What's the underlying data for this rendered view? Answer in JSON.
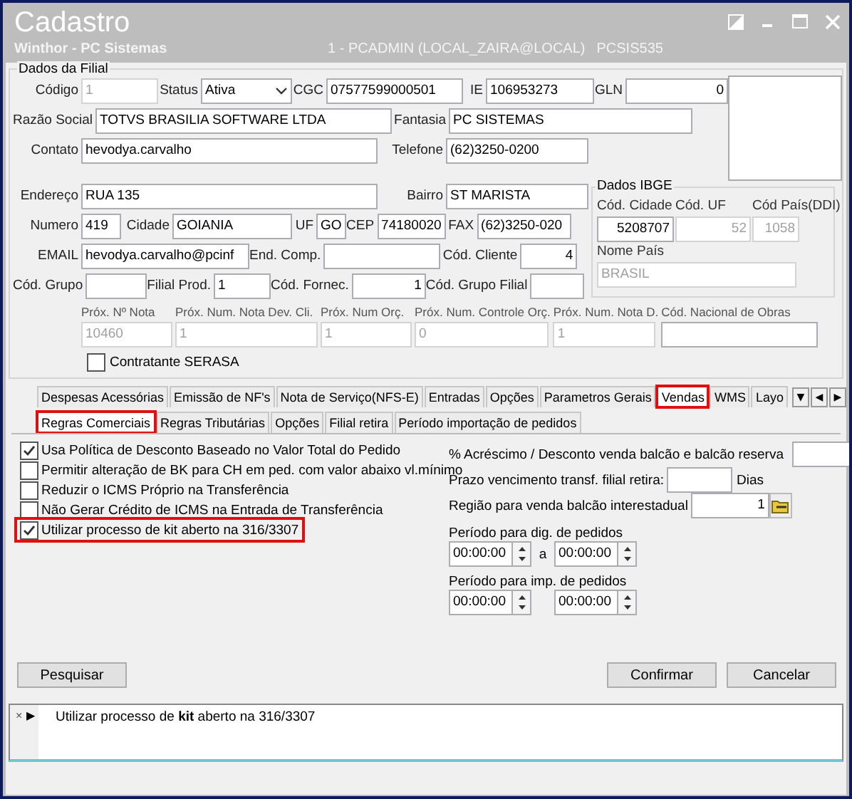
{
  "window": {
    "title": "Cadastro",
    "subtitle": "Winthor - PC Sistemas",
    "session": "1 - PCADMIN (LOCAL_ZAIRA@LOCAL)",
    "program": "PCSIS535"
  },
  "filial": {
    "title": "Dados da Filial",
    "lines": [
      {
        "fields": [
          {
            "label": "Código",
            "value": "1",
            "kind": "text",
            "disabled": true
          },
          {
            "label": "Status",
            "value": "Ativa",
            "kind": "select",
            "disabled": false
          },
          {
            "label": "CGC",
            "value": "07577599000501",
            "kind": "text",
            "disabled": false
          },
          {
            "label": "IE",
            "value": "106953273",
            "kind": "text",
            "disabled": false
          },
          {
            "label": "GLN",
            "value": "0",
            "kind": "number",
            "disabled": false
          }
        ]
      },
      {
        "fields": [
          {
            "label": "Razão Social",
            "value": "TOTVS BRASILIA SOFTWARE LTDA",
            "kind": "text",
            "disabled": false
          },
          {
            "label": "Fantasia",
            "value": "PC SISTEMAS",
            "kind": "text",
            "disabled": false
          }
        ]
      },
      {
        "fields": [
          {
            "label": "Contato",
            "value": "hevodya.carvalho",
            "kind": "text",
            "disabled": false
          },
          {
            "label": "Telefone",
            "value": "(62)3250-0200",
            "kind": "text",
            "disabled": false
          }
        ]
      },
      {
        "fields": [
          {
            "label": "Endereço",
            "value": "RUA 135",
            "kind": "text",
            "disabled": false
          },
          {
            "label": "Bairro",
            "value": "ST MARISTA",
            "kind": "text",
            "disabled": false
          }
        ]
      },
      {
        "fields": [
          {
            "label": "Numero",
            "value": "419",
            "kind": "text",
            "disabled": false
          },
          {
            "label": "Cidade",
            "value": "GOIANIA",
            "kind": "text",
            "disabled": false
          },
          {
            "label": "UF",
            "value": "GO",
            "kind": "text",
            "disabled": false
          },
          {
            "label": "CEP",
            "value": "74180020",
            "kind": "text",
            "disabled": false
          },
          {
            "label": "FAX",
            "value": "(62)3250-020",
            "kind": "text",
            "disabled": false
          }
        ]
      },
      {
        "fields": [
          {
            "label": "EMAIL",
            "value": "hevodya.carvalho@pcinf",
            "kind": "text",
            "disabled": false
          },
          {
            "label": "End. Comp.",
            "kind": "text",
            "disabled": false
          },
          {
            "label": "Cód. Cliente",
            "value": "4",
            "kind": "number",
            "disabled": false
          }
        ]
      },
      {
        "fields": [
          {
            "label": "Cód. Grupo",
            "kind": "text",
            "disabled": false
          },
          {
            "label": "Filial Prod.",
            "value": "1",
            "kind": "text",
            "disabled": false
          },
          {
            "label": "Cód. Fornec.",
            "value": "1",
            "kind": "number",
            "disabled": false
          },
          {
            "label": "Cód. Grupo Filial",
            "kind": "text",
            "disabled": false
          }
        ]
      }
    ],
    "ibge": {
      "title": "Dados IBGE",
      "fields": [
        {
          "label": "Cód. Cidade",
          "value": "5208707",
          "kind": "number",
          "disabled": false
        },
        {
          "label": "Cód. UF",
          "value": "52",
          "kind": "number",
          "disabled": true
        },
        {
          "label": "Cód País(DDI)",
          "value": "1058",
          "kind": "number",
          "disabled": true
        }
      ],
      "country": {
        "label": "Nome País",
        "value": "BRASIL",
        "kind": "text",
        "disabled": true
      }
    },
    "numbering": [
      {
        "label": "Próx. Nº Nota",
        "value": "10460",
        "disabled": true
      },
      {
        "label": "Próx. Num. Nota Dev. Cli.",
        "value": "1",
        "disabled": true
      },
      {
        "label": "Próx. Num Orç.",
        "value": "1",
        "disabled": true
      },
      {
        "label": "Próx. Num. Controle Orç.",
        "value": "0",
        "disabled": true
      },
      {
        "label": "Próx. Num. Nota D.",
        "value": "1",
        "disabled": true
      },
      {
        "label": "Cód. Nacional de Obras",
        "disabled": false
      }
    ],
    "serasa": {
      "label": "Contratante SERASA",
      "checked": false
    }
  },
  "tabs": [
    {
      "label": "Despesas Acessórias",
      "selected": false,
      "highlighted": false
    },
    {
      "label": "Emissão de NF's",
      "selected": false,
      "highlighted": false
    },
    {
      "label": "Nota de Serviço(NFS-E)",
      "selected": false,
      "highlighted": false
    },
    {
      "label": "Entradas",
      "selected": false,
      "highlighted": false
    },
    {
      "label": "Opções",
      "selected": false,
      "highlighted": false
    },
    {
      "label": "Parametros Gerais",
      "selected": false,
      "highlighted": false
    },
    {
      "label": "Vendas",
      "selected": true,
      "highlighted": true
    },
    {
      "label": "WMS",
      "selected": false,
      "highlighted": false
    },
    {
      "label": "Layo",
      "selected": false,
      "highlighted": false
    }
  ],
  "tab_scroll": [
    "▼",
    "◀",
    "▶"
  ],
  "subtabs": [
    {
      "label": "Regras Comerciais",
      "selected": true,
      "highlighted": true
    },
    {
      "label": "Regras Tributárias",
      "selected": false,
      "highlighted": false
    },
    {
      "label": "Opções",
      "selected": false,
      "highlighted": false
    },
    {
      "label": "Filial retira",
      "selected": false,
      "highlighted": false
    },
    {
      "label": "Período importação de pedidos",
      "selected": false,
      "highlighted": false
    }
  ],
  "options": [
    {
      "label": "Usa Política de Desconto Baseado no Valor Total do Pedido",
      "checked": true,
      "highlighted": false
    },
    {
      "label": "Permitir alteração de BK para CH em ped. com valor abaixo vl.mínimo",
      "checked": false,
      "highlighted": false
    },
    {
      "label": "Reduzir o ICMS Próprio na Transferência",
      "checked": false,
      "highlighted": false
    },
    {
      "label": "Não Gerar Crédito de ICMS na Entrada de Transferência",
      "checked": false,
      "highlighted": false
    },
    {
      "label": "Utilizar processo de kit aberto na 316/3307",
      "checked": true,
      "highlighted": true
    }
  ],
  "vendas": {
    "acrescimo": {
      "label": "% Acréscimo / Desconto venda balcão e balcão reserva"
    },
    "prazo": {
      "label": "Prazo vencimento transf. filial retira:",
      "unit": "Dias"
    },
    "regiao": {
      "label": "Região para venda balcão interestadual",
      "value": "1"
    },
    "periods": [
      {
        "label": "Período para dig. de pedidos",
        "from": "00:00:00",
        "separator": "a",
        "to": "00:00:00"
      },
      {
        "label": "Período para imp. de pedidos",
        "from": "00:00:00",
        "to": "00:00:00"
      }
    ]
  },
  "buttons": {
    "search": "Pesquisar",
    "confirm": "Confirmar",
    "cancel": "Cancelar"
  },
  "message": {
    "close": "×",
    "marker": "▶",
    "text": "Utilizar processo de **kit** aberto na 316/3307"
  }
}
